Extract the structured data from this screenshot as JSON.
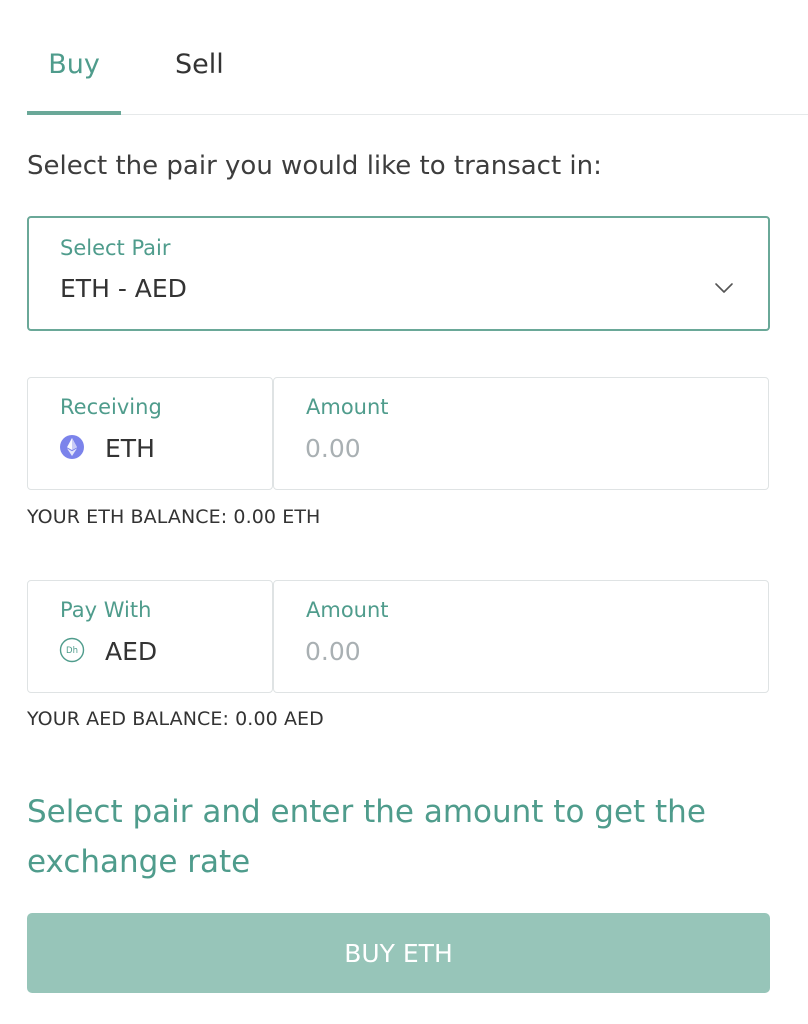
{
  "tabs": {
    "buy_label": "Buy",
    "sell_label": "Sell",
    "active": "Buy"
  },
  "prompt": "Select the pair you would like to transact in:",
  "pair_select": {
    "label": "Select Pair",
    "value": "ETH - AED",
    "icon": "chevron-down-icon"
  },
  "receiving": {
    "label": "Receiving",
    "asset": "ETH",
    "icon": "ethereum-icon",
    "amount_label": "Amount",
    "amount_placeholder": "0.00",
    "balance": "YOUR ETH BALANCE: 0.00 ETH"
  },
  "pay_with": {
    "label": "Pay With",
    "asset": "AED",
    "icon": "dirham-icon",
    "icon_text": "Dh",
    "amount_label": "Amount",
    "amount_placeholder": "0.00",
    "balance": "YOUR AED BALANCE: 0.00 AED"
  },
  "rate_message": "Select pair and enter the amount to get the exchange rate",
  "buy_button_label": "BUY ETH",
  "colors": {
    "accent": "#4f9c8c",
    "accent_border": "#6aa898",
    "button_bg": "#97c5b9",
    "ethereum": "#7b83eb"
  }
}
